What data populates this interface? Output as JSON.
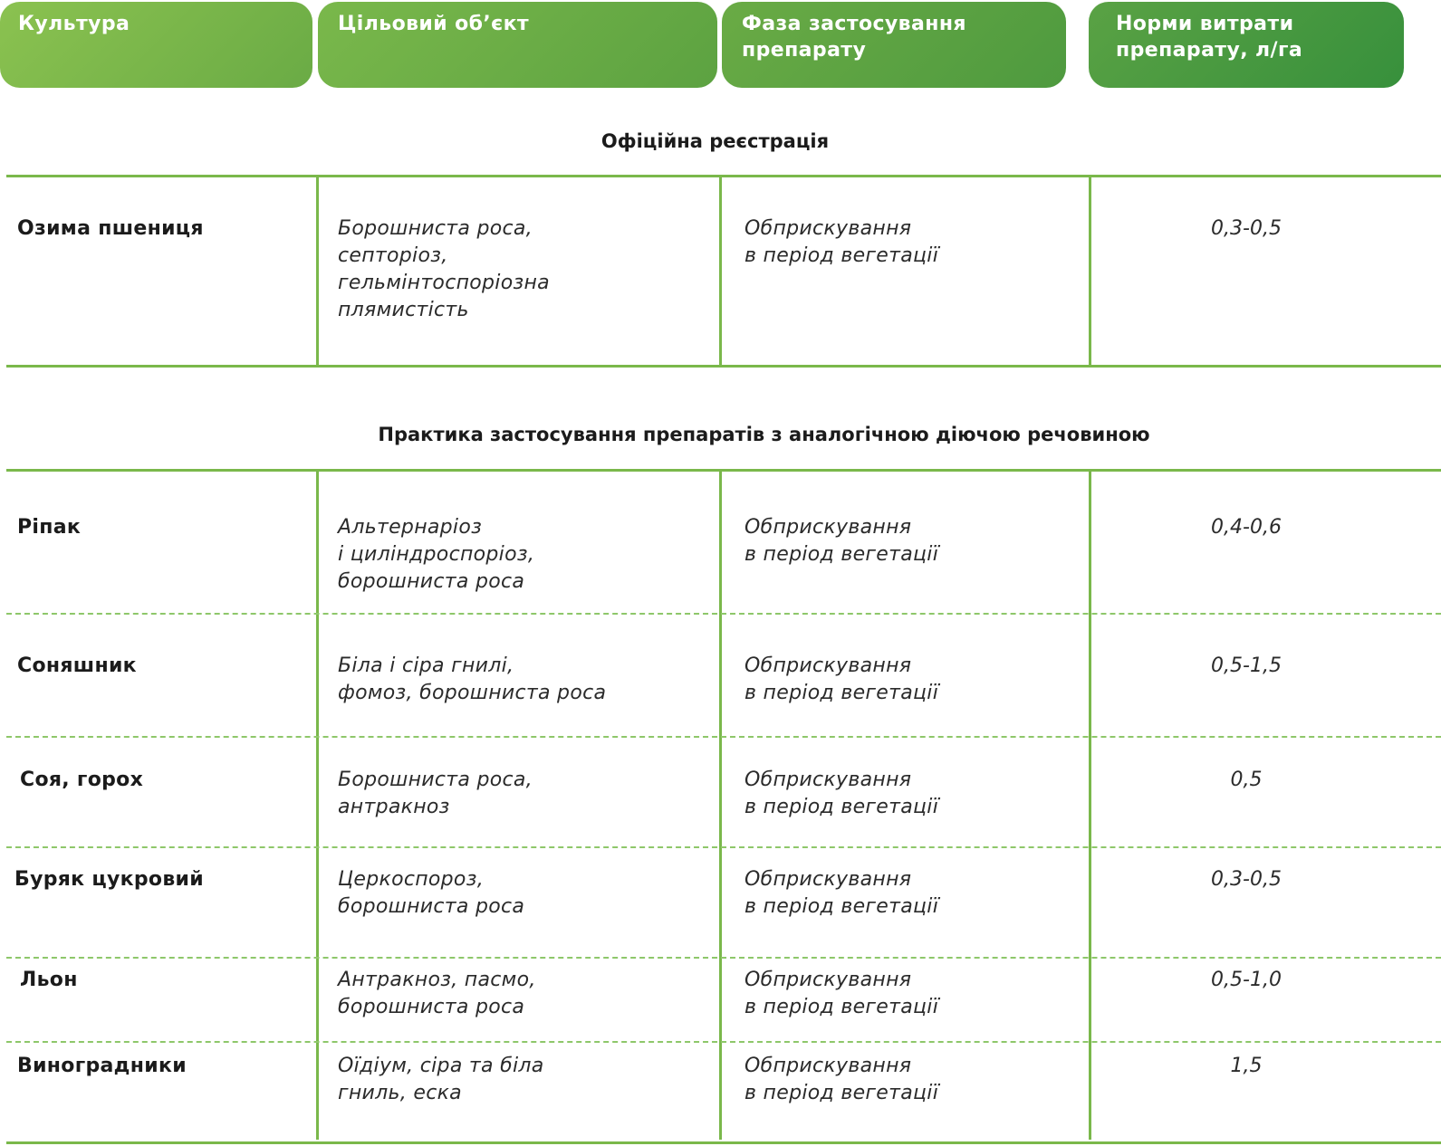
{
  "header": {
    "col1": "Культура",
    "col2": "Цільовий об’єкт",
    "col3": "Фаза застосування препарату",
    "col4": "Норми витрати препарату, л/га"
  },
  "sections": {
    "official": "Офіційна реєстрація",
    "practice": "Практика застосування препаратів з аналогічною діючою речовиною"
  },
  "rows": [
    {
      "crop": "Озима пшениця",
      "target": "Борошниста роса,\nсепторіоз,\nгельмінтоспоріозна\nплямистість",
      "phase": "Обприскування\nв період вегетації",
      "norm": "0,3-0,5"
    },
    {
      "crop": "Ріпак",
      "target": "Альтернаріоз\nі циліндроспоріоз,\nборошниста роса",
      "phase": "Обприскування\nв період вегетації",
      "norm": "0,4-0,6"
    },
    {
      "crop": "Соняшник",
      "target": "Біла і сіра гнилі,\nфомоз, борошниста роса",
      "phase": "Обприскування\nв період вегетації",
      "norm": "0,5-1,5"
    },
    {
      "crop": "Соя, горох",
      "target": "Борошниста роса,\nантракноз",
      "phase": "Обприскування\nв період вегетації",
      "norm": "0,5"
    },
    {
      "crop": "Буряк цукровий",
      "target": "Церкоспороз,\nборошниста роса",
      "phase": "Обприскування\nв період вегетації",
      "norm": "0,3-0,5"
    },
    {
      "crop": "Льон",
      "target": "Антракноз, пасмо,\nборошниста роса",
      "phase": "Обприскування\nв період вегетації",
      "norm": "0,5-1,0"
    },
    {
      "crop": "Виноградники",
      "target": "Оїдіум, сіра та біла\nгниль, еска",
      "phase": "Обприскування\nв період вегетації",
      "norm": "1,5"
    }
  ],
  "colors": {
    "accent": "#7ab84b",
    "header_dark": "#37903c",
    "header_light": "#8bc250",
    "dashed": "#8ec76a"
  }
}
